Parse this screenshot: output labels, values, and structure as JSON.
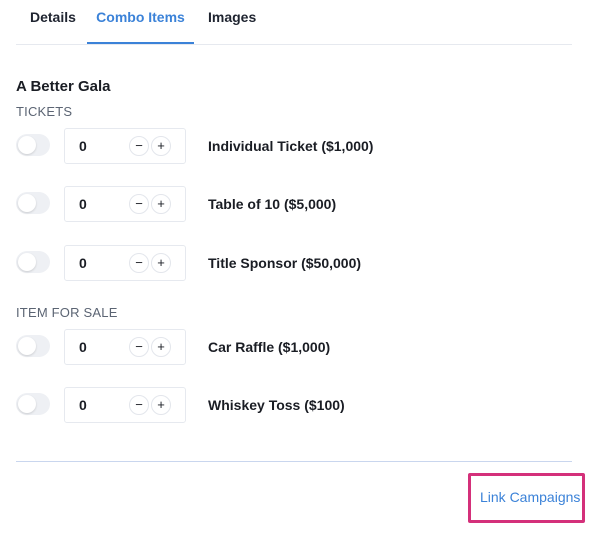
{
  "tabs": [
    {
      "label": "Details",
      "active": false
    },
    {
      "label": "Combo Items",
      "active": true
    },
    {
      "label": "Images",
      "active": false
    }
  ],
  "campaign": {
    "title": "A Better Gala"
  },
  "sections": [
    {
      "label": "TICKETS",
      "items": [
        {
          "quantity": "0",
          "label": "Individual Ticket ($1,000)",
          "enabled": false
        },
        {
          "quantity": "0",
          "label": "Table of 10 ($5,000)",
          "enabled": false
        },
        {
          "quantity": "0",
          "label": "Title Sponsor ($50,000)",
          "enabled": false
        }
      ]
    },
    {
      "label": "ITEM FOR SALE",
      "items": [
        {
          "quantity": "0",
          "label": "Car Raffle ($1,000)",
          "enabled": false
        },
        {
          "quantity": "0",
          "label": "Whiskey Toss ($100)",
          "enabled": false
        }
      ]
    }
  ],
  "stepper": {
    "minus": "−",
    "plus": "+"
  },
  "footer": {
    "link_label": "Link Campaigns"
  },
  "colors": {
    "accent": "#3b82d8",
    "highlight": "#d4307a"
  }
}
